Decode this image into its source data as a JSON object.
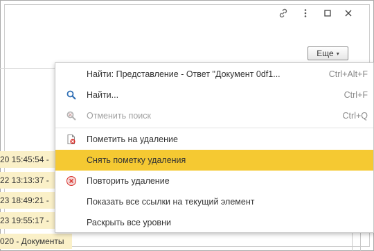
{
  "header": {
    "icons": [
      "link-icon",
      "more-vertical-icon",
      "maximize-icon",
      "close-icon"
    ]
  },
  "more_button": {
    "label": "Еще"
  },
  "rows": [
    {
      "text": "20 15:45:54 -"
    },
    {
      "text": "22 13:13:37 -"
    },
    {
      "text": "23 18:49:21 -"
    },
    {
      "text": "23 19:55:17 -"
    }
  ],
  "bottom_row": {
    "text": "020 - Документы"
  },
  "menu": {
    "items": [
      {
        "label": "Найти: Представление - Ответ \"Документ 0df1...",
        "shortcut": "Ctrl+Alt+F",
        "icon": "",
        "state": "normal"
      },
      {
        "label": "Найти...",
        "shortcut": "Ctrl+F",
        "icon": "search-icon",
        "state": "normal"
      },
      {
        "label": "Отменить поиск",
        "shortcut": "Ctrl+Q",
        "icon": "cancel-search-icon",
        "state": "disabled"
      },
      {
        "label": "Пометить на удаление",
        "shortcut": "",
        "icon": "mark-delete-icon",
        "state": "normal"
      },
      {
        "label": "Снять пометку удаления",
        "shortcut": "",
        "icon": "",
        "state": "selected"
      },
      {
        "label": "Повторить удаление",
        "shortcut": "",
        "icon": "repeat-delete-icon",
        "state": "normal"
      },
      {
        "label": "Показать все ссылки на текущий элемент",
        "shortcut": "",
        "icon": "",
        "state": "normal"
      },
      {
        "label": "Раскрыть все уровни",
        "shortcut": "",
        "icon": "",
        "state": "normal"
      }
    ]
  },
  "colors": {
    "selected": "#f5c932",
    "row_bg": "#faf0c8"
  }
}
